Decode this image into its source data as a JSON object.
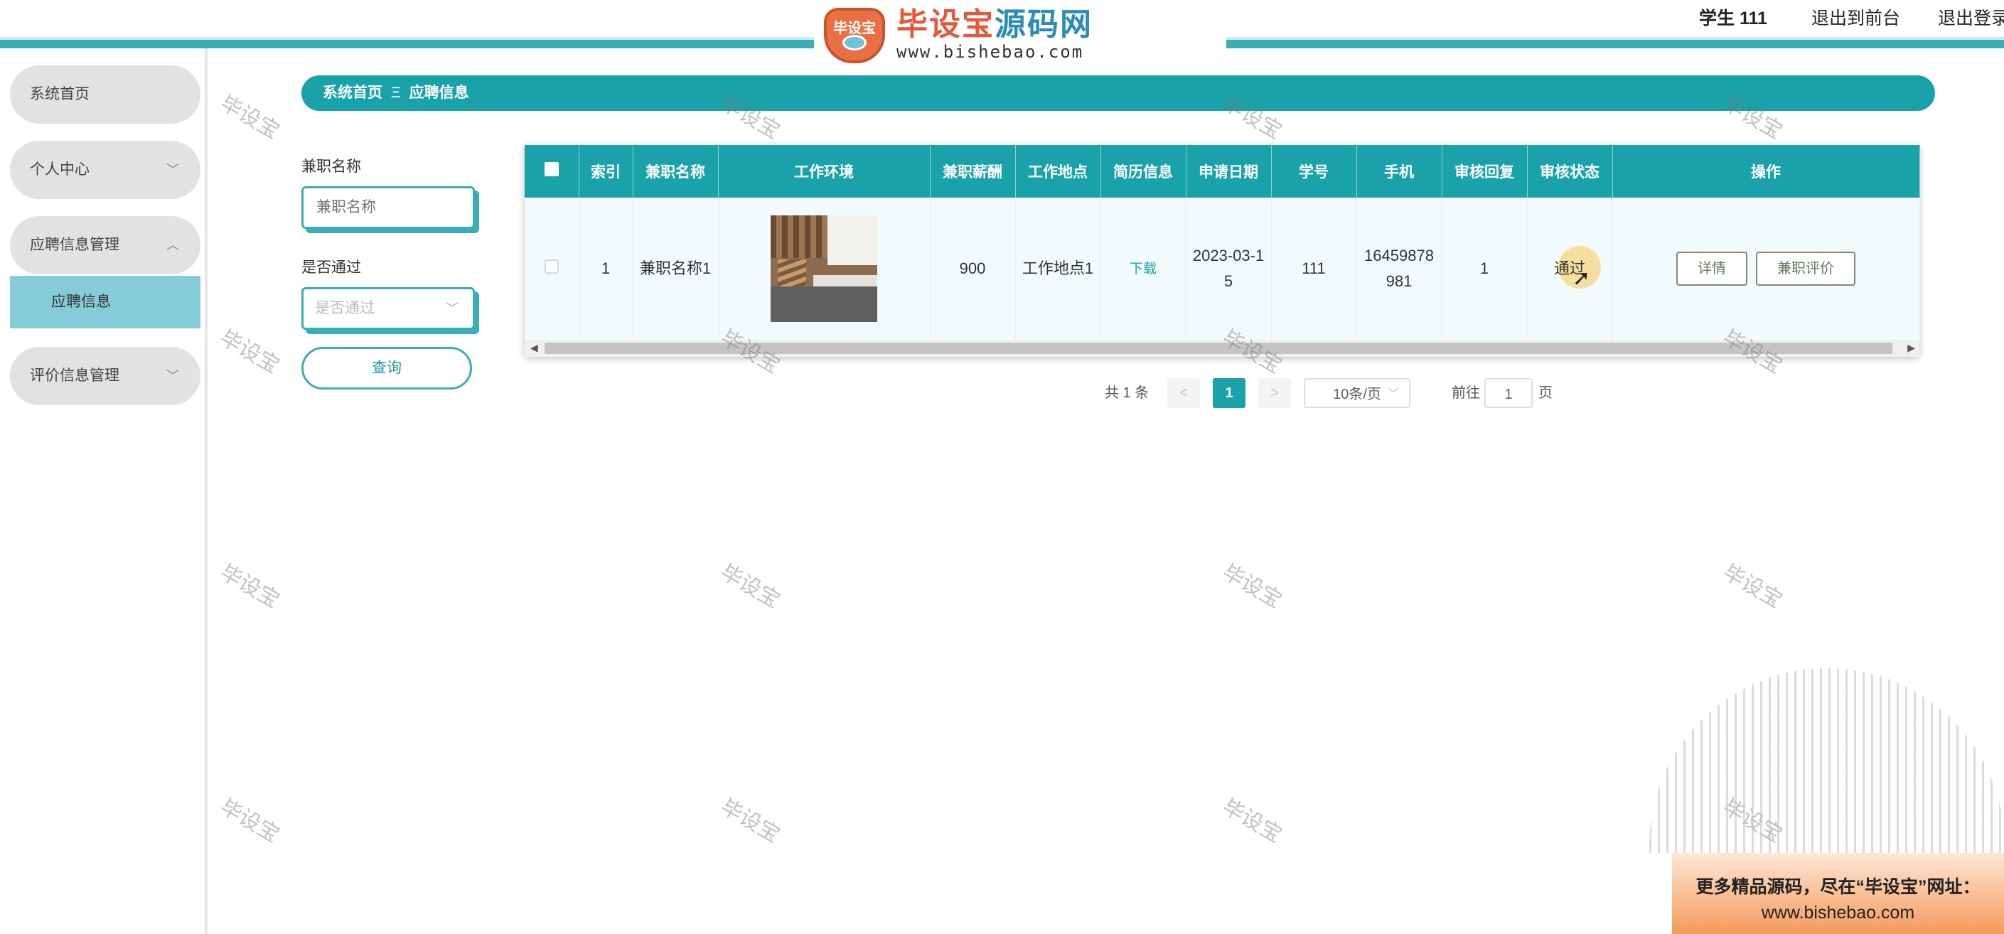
{
  "header": {
    "logo_title_a": "毕设宝",
    "logo_title_b": "源码网",
    "logo_badge": "毕设宝",
    "logo_url": "www.bishebao.com",
    "user": "学生 111",
    "front_link": "退出到前台",
    "logout_link": "退出登录"
  },
  "sidebar": {
    "home": "系统首页",
    "personal": "个人中心",
    "apply_mgmt": "应聘信息管理",
    "apply_info": "应聘信息",
    "review_mgmt": "评价信息管理"
  },
  "breadcrumb": {
    "home": "系统首页",
    "sep": "Ξ",
    "current": "应聘信息"
  },
  "filters": {
    "name_label": "兼职名称",
    "name_placeholder": "兼职名称",
    "pass_label": "是否通过",
    "pass_placeholder": "是否通过",
    "query_button": "查询"
  },
  "table": {
    "headers": [
      "索引",
      "兼职名称",
      "工作环境",
      "兼职薪酬",
      "工作地点",
      "简历信息",
      "申请日期",
      "学号",
      "手机",
      "审核回复",
      "审核状态",
      "操作"
    ],
    "row": {
      "index": "1",
      "name": "兼职名称1",
      "salary": "900",
      "location": "工作地点1",
      "resume_link": "下载",
      "date": "2023-03-15",
      "student_no": "111",
      "phone": "16459878981",
      "review_reply": "1",
      "status": "通过",
      "detail_button": "详情",
      "rate_button": "兼职评价"
    }
  },
  "pagination": {
    "total": "共 1 条",
    "prev": "<",
    "current_page": "1",
    "next": ">",
    "page_size": "10条/页",
    "goto_label": "前往",
    "goto_value": "1",
    "page_suffix": "页"
  },
  "watermark": "毕设宝",
  "ad": {
    "line1": "更多精品源码，尽在“毕设宝”网址：",
    "line2": "www.bishebao.com"
  }
}
